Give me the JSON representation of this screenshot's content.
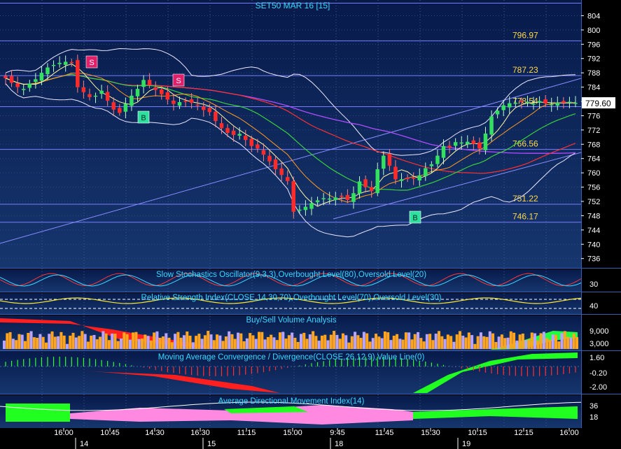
{
  "chart_data": {
    "type": "candlestick",
    "title": "SET50 MAR 16   [15]",
    "price_axis_ticks": [
      "804",
      "800",
      "796",
      "792",
      "788",
      "784",
      "780",
      "776",
      "772",
      "768",
      "764",
      "760",
      "756",
      "752",
      "748",
      "744",
      "740",
      "736"
    ],
    "price_range": [
      733,
      808
    ],
    "last_price": "779.60",
    "levels": [
      "796.97",
      "787.23",
      "778.54",
      "766.56",
      "751.22",
      "746.17"
    ],
    "time_axis_labels": [
      "16:00",
      "10:45",
      "14:30",
      "16:30",
      "11:15",
      "15:00",
      "9:45",
      "11:45",
      "15:30",
      "10:15",
      "12:15",
      "16:00"
    ],
    "date_labels": [
      "14",
      "15",
      "18",
      "19"
    ],
    "signals": [
      "S",
      "S",
      "B",
      "B"
    ],
    "closes": [
      786.5,
      785.2,
      784.0,
      783.5,
      785.0,
      786.2,
      788.0,
      789.5,
      790.2,
      790.8,
      791.1,
      791.0,
      784.0,
      782.6,
      781.2,
      781.6,
      783.0,
      780.2,
      777.7,
      776.8,
      779.3,
      781.6,
      783.5,
      786.0,
      784.5,
      783.2,
      782.0,
      780.5,
      779.3,
      779.8,
      780.2,
      779.6,
      778.8,
      777.6,
      777.0,
      774.5,
      772.5,
      771.2,
      770.6,
      770.9,
      769.2,
      767.5,
      766.8,
      765.1,
      763.2,
      761.0,
      759.4,
      757.7,
      749.1,
      749.7,
      750.5,
      751.5,
      752.3,
      752.9,
      752.8,
      753.1,
      753.5,
      752.4,
      754.3,
      757.6,
      756.0,
      754.9,
      761.0,
      764.8,
      762.0,
      758.2,
      758.2,
      758.3,
      758.4,
      759.3,
      761.3,
      762.4,
      764.8,
      767.5,
      767.0,
      768.6,
      768.5,
      768.7,
      768.1,
      766.8,
      771.0,
      775.8,
      777.4,
      778.9,
      779.5,
      779.6,
      779.9,
      779.9,
      779.4,
      780.1,
      779.4,
      779.2,
      779.6,
      779.6,
      779.9,
      779.6
    ],
    "indicators": {
      "stochastic": {
        "title": "Slow Stochastics Oscillator(9,3,3),Overbought Level(80),Oversold Level(20)",
        "ticks": [
          "30"
        ]
      },
      "rsi": {
        "title": "Relative Strength Index(CLOSE,14,30,70),Overbought Level(70),Oversold Level(30)",
        "ticks": [
          "40"
        ]
      },
      "volume": {
        "title": "Buy/Sell Volume Analysis",
        "ticks": [
          "9,000",
          "3,000"
        ]
      },
      "macd": {
        "title": "Moving Average Convergence / Divergence(CLOSE,26,12,9),Value Line(0)",
        "ticks": [
          "1.60",
          "-0.20",
          "-2.00"
        ]
      },
      "adx": {
        "title": "Average Directional Movement Index(14)",
        "ticks": [
          "36",
          "18"
        ]
      }
    }
  }
}
